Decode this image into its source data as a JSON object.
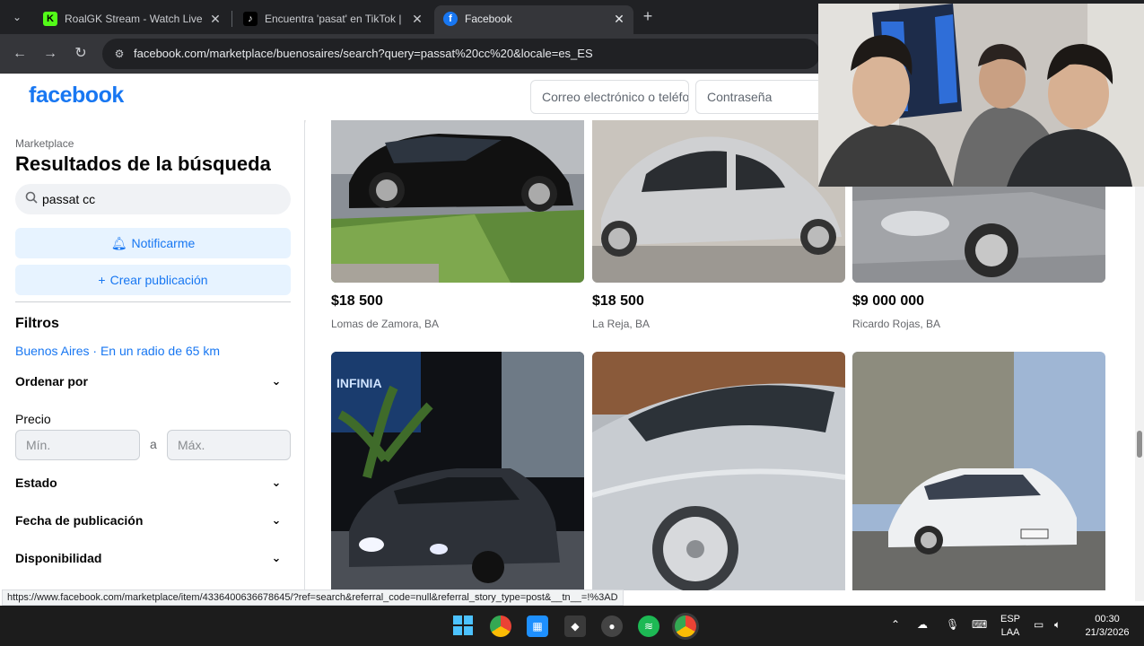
{
  "browser": {
    "tabs": [
      {
        "title": "RoalGK Stream - Watch Live on",
        "favicon": "K"
      },
      {
        "title": "Encuentra 'pasat' en TikTok | Bu",
        "favicon": "♪"
      },
      {
        "title": "Facebook",
        "favicon": "f"
      }
    ],
    "url": "facebook.com/marketplace/buenosaires/search?query=passat%20cc%20&locale=es_ES",
    "status_url": "https://www.facebook.com/marketplace/item/4336400636678645/?ref=search&referral_code=null&referral_story_type=post&__tn__=!%3AD"
  },
  "header": {
    "logo": "facebook",
    "email_placeholder": "Correo electrónico o teléfono",
    "password_placeholder": "Contraseña"
  },
  "sidebar": {
    "breadcrumb": "Marketplace",
    "title": "Resultados de la búsqueda",
    "search_value": "passat cc",
    "notify_label": "Notificarme",
    "create_label": "Crear publicación",
    "filters_heading": "Filtros",
    "location": "Buenos Aires · En un radio de 65 km",
    "sort_label": "Ordenar por",
    "price_label": "Precio",
    "price_min": "Mín.",
    "price_to": "a",
    "price_max": "Máx.",
    "condition_label": "Estado",
    "date_label": "Fecha de publicación",
    "availability_label": "Disponibilidad"
  },
  "listings": [
    {
      "price": "$18 500",
      "location": "Lomas de Zamora, BA"
    },
    {
      "price": "$18 500",
      "location": "La Reja, BA"
    },
    {
      "price": "$9 000 000",
      "location": "Ricardo Rojas, BA"
    },
    {
      "price": "",
      "location": ""
    },
    {
      "price": "",
      "location": ""
    },
    {
      "price": "",
      "location": ""
    }
  ],
  "taskbar": {
    "language": "ESP",
    "layout": "LAA",
    "time": "00:30",
    "date": "21/3/2026"
  },
  "colors": {
    "facebook_blue": "#1877f2",
    "light_blue_button": "#e7f3ff",
    "tab_bar": "#202124"
  }
}
